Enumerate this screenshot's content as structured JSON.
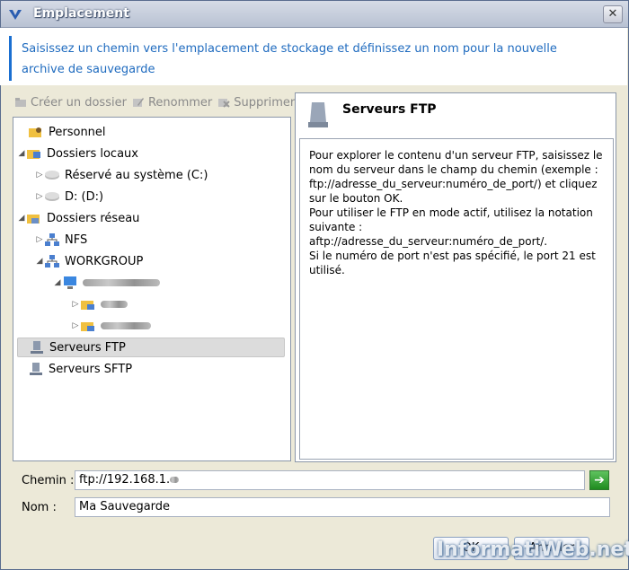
{
  "window": {
    "title": "Emplacement"
  },
  "banner": {
    "text": "Saisissez un chemin vers l'emplacement de stockage et définissez un nom pour la nouvelle archive de sauvegarde"
  },
  "toolbar": {
    "create": "Créer un dossier",
    "rename": "Renommer",
    "delete": "Supprimer"
  },
  "tree": {
    "personnel": "Personnel",
    "dossiers_locaux": "Dossiers locaux",
    "reserve_systeme": "Réservé au système (C:)",
    "disk_d": "D: (D:)",
    "dossiers_reseau": "Dossiers réseau",
    "nfs": "NFS",
    "workgroup": "WORKGROUP",
    "serveurs_ftp": "Serveurs FTP",
    "serveurs_sftp": "Serveurs SFTP"
  },
  "info": {
    "title": "Serveurs FTP",
    "body1": "Pour explorer le contenu d'un serveur FTP, saisissez le nom du serveur dans le champ du chemin (exemple : ftp://adresse_du_serveur:numéro_de_port/) et cliquez sur le bouton OK.",
    "body2": "Pour utiliser le FTP en mode actif, utilisez la notation suivante : aftp://adresse_du_serveur:numéro_de_port/.",
    "body3": "Si le numéro de port n'est pas spécifié, le port 21 est utilisé."
  },
  "form": {
    "path_label": "Chemin :",
    "path_value": "ftp://192.168.1.",
    "name_label": "Nom :",
    "name_value": "Ma Sauvegarde"
  },
  "buttons": {
    "ok": "OK",
    "cancel": "Annuler"
  },
  "watermark": "InformatiWeb.net",
  "colors": {
    "accent": "#1a6fd1",
    "banner_text": "#1f6bbf",
    "go_button": "#1f8b1f"
  }
}
